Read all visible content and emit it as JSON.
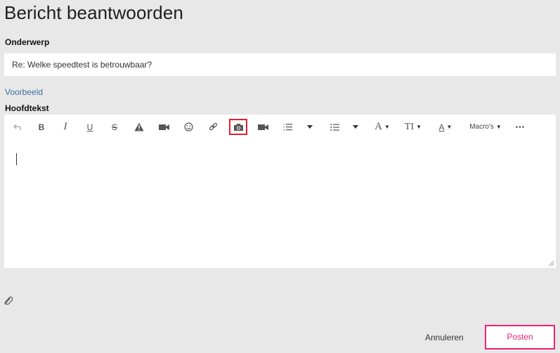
{
  "page": {
    "title": "Bericht beantwoorden"
  },
  "subject": {
    "label": "Onderwerp",
    "value": "Re: Welke speedtest is betrouwbaar?"
  },
  "preview": {
    "link": "Voorbeeld"
  },
  "body": {
    "label": "Hoofdtekst"
  },
  "toolbar": {
    "buttons": [
      {
        "name": "undo-icon"
      },
      {
        "name": "bold-icon",
        "glyph": "B"
      },
      {
        "name": "italic-icon",
        "glyph": "I"
      },
      {
        "name": "underline-icon",
        "glyph": "U"
      },
      {
        "name": "strikethrough-icon",
        "glyph": "S"
      },
      {
        "name": "warning-icon"
      },
      {
        "name": "video-icon"
      },
      {
        "name": "emoji-icon"
      },
      {
        "name": "link-icon"
      },
      {
        "name": "camera-icon",
        "highlighted": true
      },
      {
        "name": "video-embed-icon"
      },
      {
        "name": "numbered-list-icon"
      },
      {
        "name": "bullet-list-icon"
      },
      {
        "name": "font-color-icon",
        "glyph": "A"
      },
      {
        "name": "font-size-icon",
        "glyph": "TI"
      },
      {
        "name": "text-color-icon",
        "glyph": "A"
      },
      {
        "name": "more-icon"
      }
    ],
    "macros_label": "Macro's"
  },
  "actions": {
    "cancel": "Annuleren",
    "post": "Posten"
  },
  "colors": {
    "accent": "#e8247a",
    "link": "#3e6fa3",
    "highlight": "#e0202c"
  }
}
